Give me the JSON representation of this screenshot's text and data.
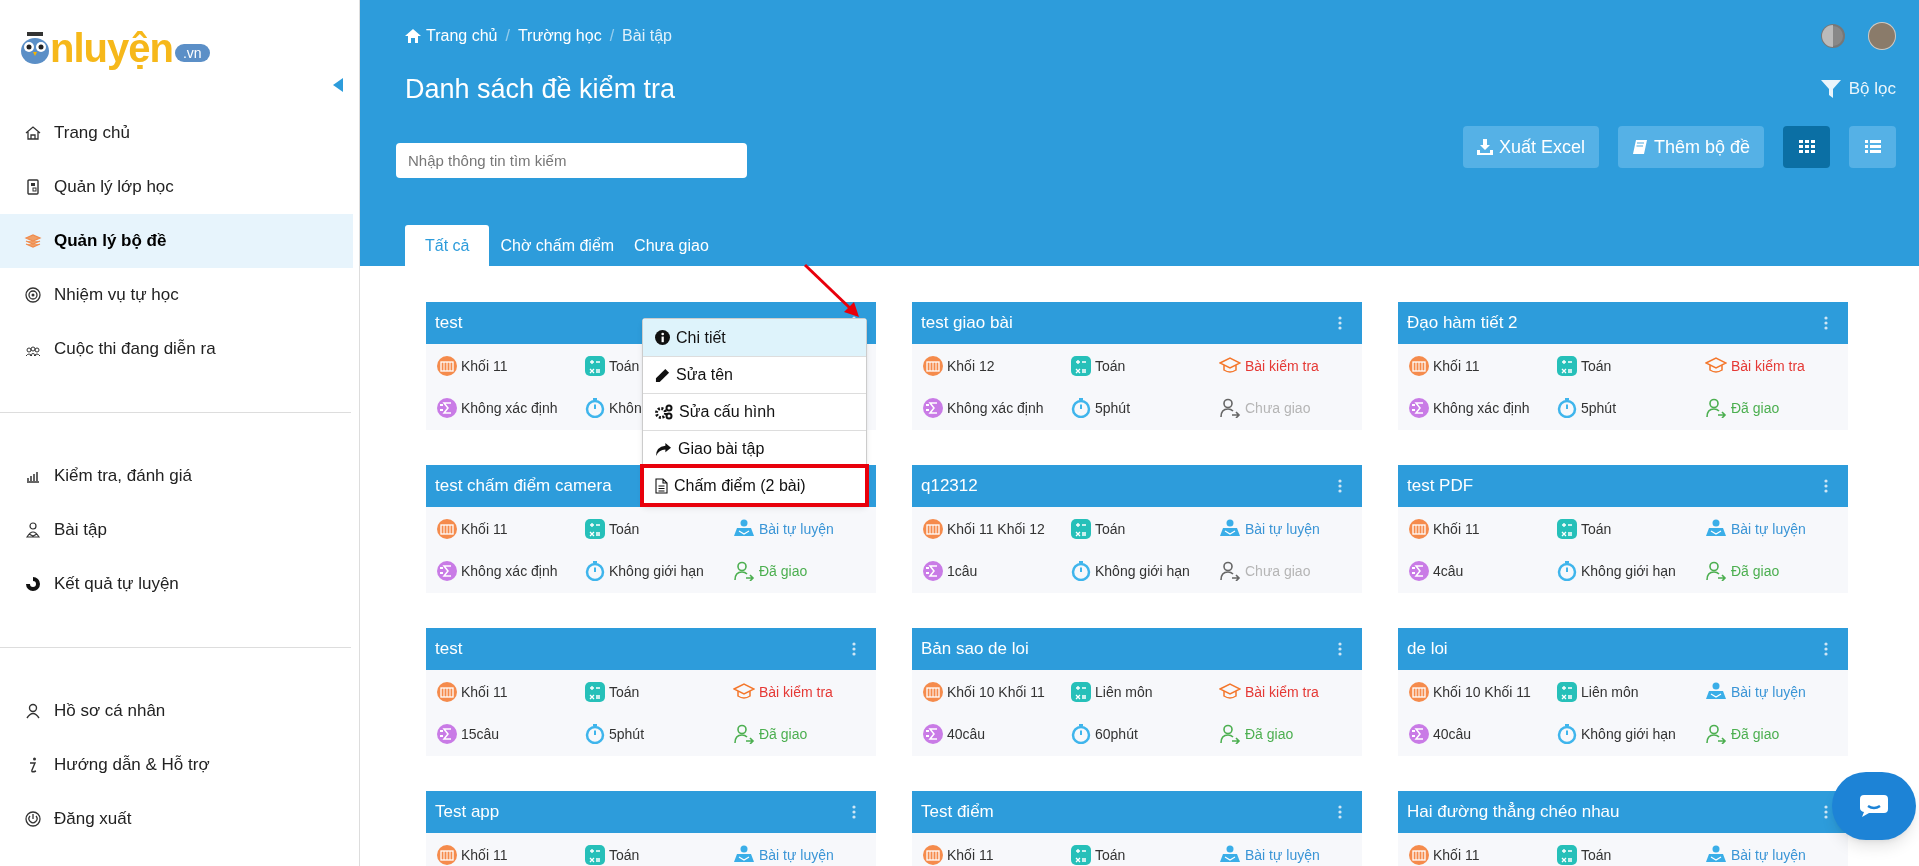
{
  "logo": {
    "main": "nluyện",
    "badge": ".vn"
  },
  "sidebar": {
    "groups": [
      {
        "items": [
          {
            "label": "Trang chủ",
            "selected": false
          },
          {
            "label": "Quản lý lớp học",
            "selected": false
          },
          {
            "label": "Quản lý bộ đề",
            "selected": true
          },
          {
            "label": "Nhiệm vụ tự học",
            "selected": false
          },
          {
            "label": "Cuộc thi đang diễn ra",
            "selected": false
          }
        ]
      },
      {
        "items": [
          {
            "label": "Kiểm tra, đánh giá",
            "selected": false
          },
          {
            "label": "Bài tập",
            "selected": false
          },
          {
            "label": "Kết quả tự luyện",
            "selected": false
          }
        ]
      },
      {
        "items": [
          {
            "label": "Hồ sơ cá nhân",
            "selected": false
          },
          {
            "label": "Hướng dẫn & Hỗ trợ",
            "selected": false
          },
          {
            "label": "Đăng xuất",
            "selected": false
          }
        ]
      }
    ]
  },
  "header": {
    "breadcrumb": [
      "Trang chủ",
      "Trường học",
      "Bài tập"
    ],
    "separator": "/",
    "title": "Danh sách đề kiểm tra",
    "filter": "Bộ lọc",
    "search": {
      "placeholder": "Nhập thông tin tìm kiếm"
    },
    "buttons": [
      {
        "kind": "download",
        "label": "Xuất Excel"
      },
      {
        "kind": "book",
        "label": "Thêm bộ đề"
      }
    ],
    "view_toggle": [
      {
        "kind": "grid",
        "selected": true
      },
      {
        "kind": "list",
        "selected": false
      }
    ],
    "tabs": [
      {
        "label": "Tất cả",
        "selected": true
      },
      {
        "label": "Chờ chấm điểm",
        "selected": false
      },
      {
        "label": "Chưa giao",
        "selected": false
      }
    ]
  },
  "cards": [
    {
      "title": "test",
      "grade": "Khối 11",
      "subject": "Toán",
      "questions": "Không xác định",
      "time": "Khôn"
    },
    {
      "title": "test giao bài",
      "grade": "Khối 12",
      "subject": "Toán",
      "type": {
        "kind": "test",
        "label": "Bài kiểm tra"
      },
      "questions": "Không xác định",
      "time": "5phút",
      "status": {
        "kind": "unassigned",
        "label": "Chưa giao"
      }
    },
    {
      "title": "Đạo hàm tiết 2",
      "grade": "Khối 11",
      "subject": "Toán",
      "type": {
        "kind": "test",
        "label": "Bài kiểm tra"
      },
      "questions": "Không xác định",
      "time": "5phút",
      "status": {
        "kind": "assigned",
        "label": "Đã giao"
      }
    },
    {
      "title": "test chấm điểm camera",
      "grade": "Khối 11",
      "subject": "Toán",
      "type": {
        "kind": "practice",
        "label": "Bài tự luyện"
      },
      "questions": "Không xác định",
      "time": "Không giới hạn",
      "status": {
        "kind": "assigned",
        "label": "Đã giao"
      }
    },
    {
      "title": "q12312",
      "grade": "Khối 11 Khối 12",
      "subject": "Toán",
      "type": {
        "kind": "practice",
        "label": "Bài tự luyện"
      },
      "questions": "1câu",
      "time": "Không giới hạn",
      "status": {
        "kind": "unassigned",
        "label": "Chưa giao"
      }
    },
    {
      "title": "test PDF",
      "grade": "Khối 11",
      "subject": "Toán",
      "type": {
        "kind": "practice",
        "label": "Bài tự luyện"
      },
      "questions": "4câu",
      "time": "Không giới hạn",
      "status": {
        "kind": "assigned",
        "label": "Đã giao"
      }
    },
    {
      "title": "test",
      "grade": "Khối 11",
      "subject": "Toán",
      "type": {
        "kind": "test",
        "label": "Bài kiểm tra"
      },
      "questions": "15câu",
      "time": "5phút",
      "status": {
        "kind": "assigned",
        "label": "Đã giao"
      }
    },
    {
      "title": "Bản sao de loi",
      "grade": "Khối 10 Khối 11",
      "subject": "Liên môn",
      "type": {
        "kind": "test",
        "label": "Bài kiểm tra"
      },
      "questions": "40câu",
      "time": "60phút",
      "status": {
        "kind": "assigned",
        "label": "Đã giao"
      }
    },
    {
      "title": "de loi",
      "grade": "Khối 10 Khối 11",
      "subject": "Liên môn",
      "type": {
        "kind": "practice",
        "label": "Bài tự luyện"
      },
      "questions": "40câu",
      "time": "Không giới hạn",
      "status": {
        "kind": "assigned",
        "label": "Đã giao"
      }
    },
    {
      "title": "Test app",
      "grade": "Khối 11",
      "subject": "Toán",
      "type": {
        "kind": "practice",
        "label": "Bài tự luyện"
      }
    },
    {
      "title": "Test điểm",
      "grade": "Khối 11",
      "subject": "Toán",
      "type": {
        "kind": "practice",
        "label": "Bài tự luyện"
      }
    },
    {
      "title": "Hai đường thẳng chéo nhau",
      "grade": "Khối 11",
      "subject": "Toán",
      "type": {
        "kind": "practice",
        "label": "Bài tự luyện"
      }
    }
  ],
  "context_menu": {
    "items": [
      {
        "kind": "info",
        "label": "Chi tiết",
        "highlighted": true,
        "marked": false
      },
      {
        "kind": "edit",
        "label": "Sửa tên",
        "highlighted": false,
        "marked": false
      },
      {
        "kind": "config",
        "label": "Sửa cấu hình",
        "highlighted": false,
        "marked": false
      },
      {
        "kind": "assign",
        "label": "Giao bài tập",
        "highlighted": false,
        "marked": false
      },
      {
        "kind": "grade",
        "label": "Chấm điểm (2 bài)",
        "highlighted": false,
        "marked": true
      }
    ]
  }
}
